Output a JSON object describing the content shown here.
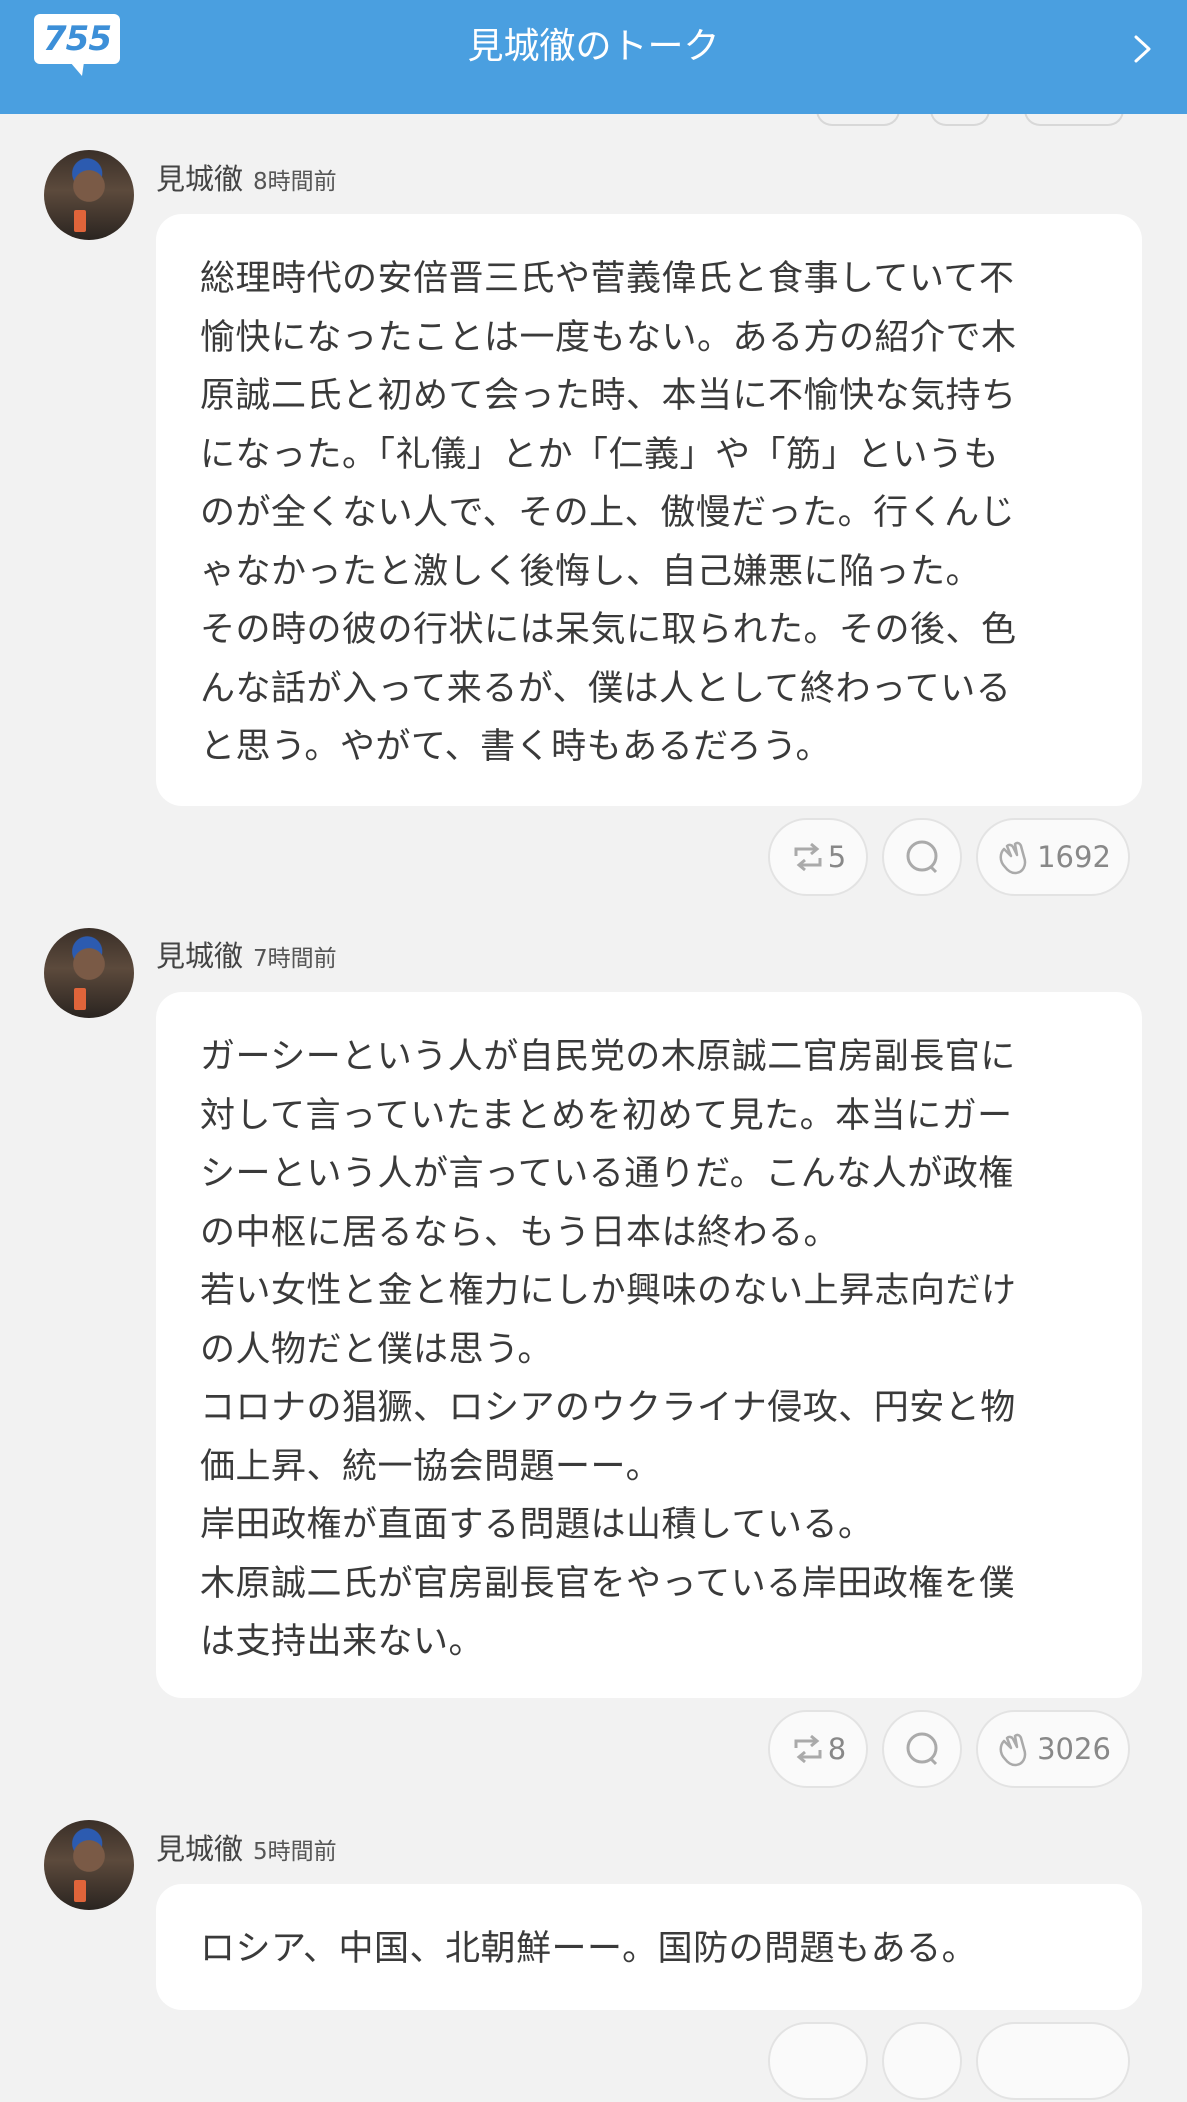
{
  "header": {
    "logo_text": "755",
    "title": "見城徹のトーク"
  },
  "posts": [
    {
      "author": "見城徹",
      "time": "8時間前",
      "lines": [
        "総理時代の安倍晋三氏や菅義偉氏と食事していて不",
        "愉快になったことは一度もない。ある方の紹介で木",
        "原誠二氏と初めて会った時、本当に不愉快な気持ち",
        "になった。「礼儀」とか「仁義」や「筋」というも",
        "のが全くない人で、その上、傲慢だった。行くんじ",
        "ゃなかったと激しく後悔し、自己嫌悪に陥った。",
        "その時の彼の行状には呆気に取られた。その後、色",
        "んな話が入って来るが、僕は人として終わっている",
        "と思う。やがて、書く時もあるだろう。"
      ],
      "repost_count": "5",
      "clap_count": "1692"
    },
    {
      "author": "見城徹",
      "time": "7時間前",
      "lines": [
        "ガーシーという人が自民党の木原誠二官房副長官に",
        "対して言っていたまとめを初めて見た。本当にガー",
        "シーという人が言っている通りだ。こんな人が政権",
        "の中枢に居るなら、もう日本は終わる。",
        "若い女性と金と権力にしか興味のない上昇志向だけ",
        "の人物だと僕は思う。",
        "コロナの猖獗、ロシアのウクライナ侵攻、円安と物",
        "価上昇、統一協会問題ーー。",
        "岸田政権が直面する問題は山積している。",
        "木原誠二氏が官房副長官をやっている岸田政権を僕",
        "は支持出来ない。"
      ],
      "repost_count": "8",
      "clap_count": "3026"
    },
    {
      "author": "見城徹",
      "time": "5時間前",
      "lines": [
        "ロシア、中国、北朝鮮ーー。国防の問題もある。"
      ]
    }
  ]
}
